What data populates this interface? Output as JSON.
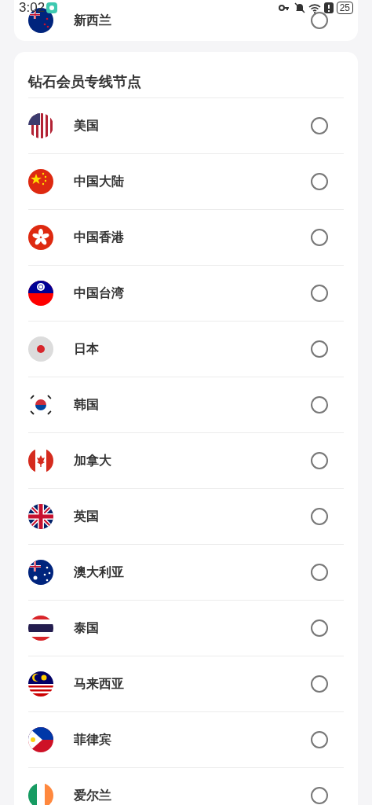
{
  "status_bar": {
    "time": "3:02",
    "battery": "25"
  },
  "top_card": {
    "rows": [
      {
        "name": "新西兰",
        "selected": false
      }
    ]
  },
  "section": {
    "title": "钻石会员专线节点",
    "rows": [
      {
        "name": "美国",
        "selected": false
      },
      {
        "name": "中国大陆",
        "selected": false
      },
      {
        "name": "中国香港",
        "selected": false
      },
      {
        "name": "中国台湾",
        "selected": false
      },
      {
        "name": "日本",
        "selected": false
      },
      {
        "name": "韩国",
        "selected": false
      },
      {
        "name": "加拿大",
        "selected": false
      },
      {
        "name": "英国",
        "selected": false
      },
      {
        "name": "澳大利亚",
        "selected": false
      },
      {
        "name": "泰国",
        "selected": false
      },
      {
        "name": "马来西亚",
        "selected": false
      },
      {
        "name": "菲律宾",
        "selected": false
      },
      {
        "name": "爱尔兰",
        "selected": false
      }
    ]
  }
}
